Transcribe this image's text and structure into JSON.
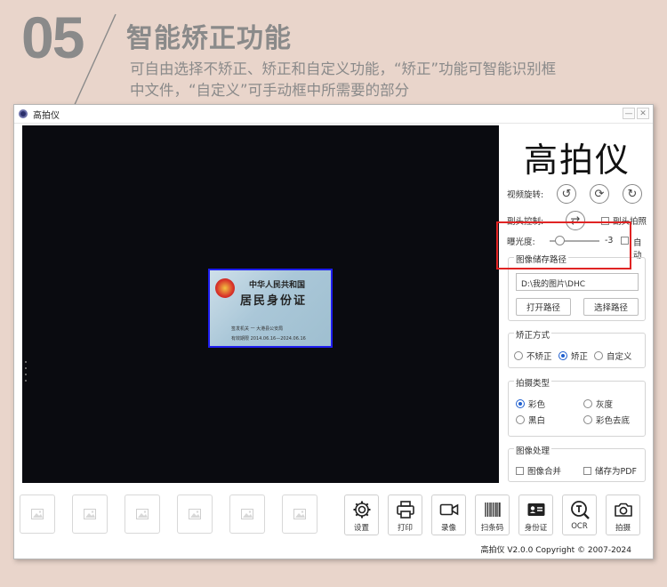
{
  "banner": {
    "number": "05",
    "title": "智能矫正功能",
    "desc_line1": "可自由选择不矫正、矫正和自定义功能，“矫正”功能可智能识别框",
    "desc_line2": "中文件，“自定义”可手动框中所需要的部分"
  },
  "window": {
    "title": "高拍仪",
    "min_label": "—",
    "close_label": "✕"
  },
  "idcard": {
    "country": "中华人民共和国",
    "title": "居民身份证",
    "issuer": "签发机关  一 大港县公安局",
    "validity": "有效期限  2014.06.16—2024.06.16"
  },
  "panel": {
    "brand": "高拍仪",
    "rotate_label": "视频旋转:",
    "secondary_label": "副头控制:",
    "secondary_shot": "副头拍照",
    "exposure_label": "曝光度:",
    "exposure_value": "-3",
    "exposure_level": 0.2,
    "auto_label": "自动",
    "path_group": {
      "title": "图像储存路径",
      "path": "D:\\我的图片\\DHC",
      "open_button": "打开路径",
      "choose_button": "选择路径"
    },
    "correction_group": {
      "title": "矫正方式",
      "options": [
        "不矫正",
        "矫正",
        "自定义"
      ],
      "selected": 1
    },
    "shoot_group": {
      "title": "拍摄类型",
      "options": [
        "彩色",
        "灰度",
        "黑白",
        "彩色去底"
      ],
      "selected": 0
    },
    "process_group": {
      "title": "图像处理",
      "merge": "图像合并",
      "pdf": "储存为PDF"
    }
  },
  "toolbar": {
    "settings": "设置",
    "print": "打印",
    "record": "录像",
    "barcode": "扫条码",
    "idcard": "身份证",
    "ocr": "OCR",
    "capture": "拍摄"
  },
  "footer": "高拍仪 V2.0.0 Copyright © 2007-2024",
  "colors": {
    "accent": "#1f5fcf",
    "highlight": "#e02424",
    "banner_text": "#8a8a8a"
  }
}
